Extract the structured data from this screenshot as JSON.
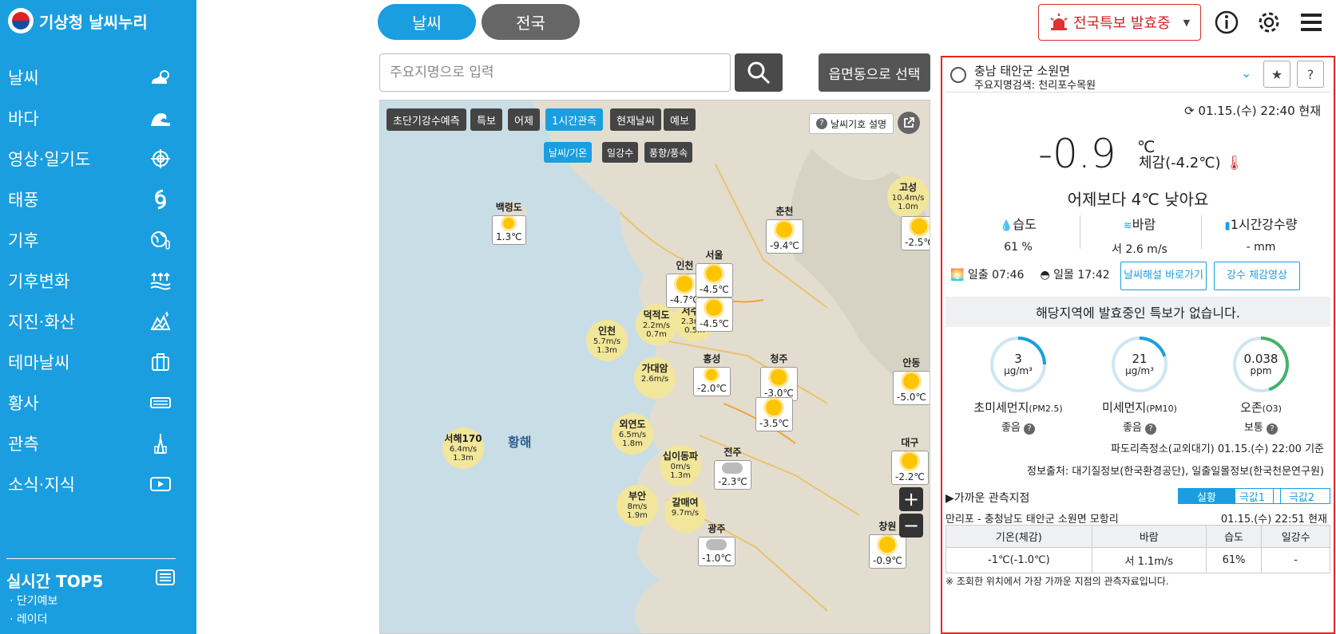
{
  "sidebar": {
    "title": "기상청 날씨누리",
    "items": [
      {
        "label": "날씨",
        "icon": "weather-icon"
      },
      {
        "label": "바다",
        "icon": "wave-icon"
      },
      {
        "label": "영상·일기도",
        "icon": "target-icon"
      },
      {
        "label": "태풍",
        "icon": "typhoon-icon"
      },
      {
        "label": "기후",
        "icon": "globe-icon"
      },
      {
        "label": "기후변화",
        "icon": "flood-icon"
      },
      {
        "label": "지진·화산",
        "icon": "earthquake-icon"
      },
      {
        "label": "테마날씨",
        "icon": "bag-icon"
      },
      {
        "label": "황사",
        "icon": "dust-icon"
      },
      {
        "label": "관측",
        "icon": "tower-icon"
      },
      {
        "label": "소식·지식",
        "icon": "video-icon"
      }
    ],
    "top5_title": "실시간 TOP5",
    "top5_links": [
      "· 단기예보",
      "· 레이더"
    ]
  },
  "top_tabs": {
    "weather": "날씨",
    "nation": "전국"
  },
  "search": {
    "placeholder": "주요지명으로 입력"
  },
  "emd_button": "읍면동으로 선택",
  "warning_button": "전국특보 발효중",
  "map": {
    "tabs": [
      "초단기강수예측",
      "특보",
      "어제",
      "1시간관측",
      "현재날씨",
      "예보"
    ],
    "active_tab": "1시간관측",
    "subtabs": [
      "날씨/기온",
      "일강수",
      "풍향/풍속"
    ],
    "active_subtab": "날씨/기온",
    "legend_label": "날씨기호 설명",
    "sea_label": "황해",
    "stations": [
      {
        "name": "백령도",
        "temp": "1.3℃",
        "icon": "sun-cloud"
      },
      {
        "name": "인천",
        "temp": "-4.7℃",
        "icon": "sun"
      },
      {
        "name": "서울",
        "temp": "-4.5℃",
        "icon": "sun"
      },
      {
        "name": "",
        "temp": "-4.5℃",
        "icon": "sun"
      },
      {
        "name": "춘천",
        "temp": "-9.4℃",
        "icon": "sun"
      },
      {
        "name": "",
        "temp": "-2.5℃",
        "icon": "sun"
      },
      {
        "name": "홍성",
        "temp": "-2.0℃",
        "icon": "sun-cloud"
      },
      {
        "name": "청주",
        "temp": "-3.0℃",
        "icon": "sun"
      },
      {
        "name": "",
        "temp": "-3.5℃",
        "icon": "sun"
      },
      {
        "name": "안동",
        "temp": "-5.0℃",
        "icon": "sun"
      },
      {
        "name": "전주",
        "temp": "-2.3℃",
        "icon": "cloud"
      },
      {
        "name": "대구",
        "temp": "-2.2℃",
        "icon": "sun"
      },
      {
        "name": "광주",
        "temp": "-1.0℃",
        "icon": "cloud"
      },
      {
        "name": "창원",
        "temp": "-0.9℃",
        "icon": "sun"
      }
    ],
    "buoys": [
      {
        "name": "고성",
        "wind": "10.4m/s",
        "wave": "1.0m"
      },
      {
        "name": "덕적도",
        "wind": "2.2m/s",
        "wave": "0.7m"
      },
      {
        "name": "서수도",
        "wind": "2.3m/s",
        "wave": "0.5m"
      },
      {
        "name": "인천",
        "wind": "5.7m/s",
        "wave": "1.3m"
      },
      {
        "name": "가대암",
        "wind": "2.6m/s",
        "wave": ""
      },
      {
        "name": "외연도",
        "wind": "6.5m/s",
        "wave": "1.8m"
      },
      {
        "name": "서해170",
        "wind": "6.4m/s",
        "wave": "1.3m"
      },
      {
        "name": "십이동파",
        "wind": "0m/s",
        "wave": "1.3m"
      },
      {
        "name": "부안",
        "wind": "8m/s",
        "wave": "1.9m"
      },
      {
        "name": "갈매여",
        "wind": "9.7m/s",
        "wave": ""
      }
    ]
  },
  "panel": {
    "location": "충남 태안군 소원면",
    "sub_location": "주요지명검색: 천리포수목원",
    "obs_time": "01.15.(수) 22:40 현재",
    "temperature": "-0.9",
    "temp_unit": "℃",
    "feels_like": "체감(-4.2℃)",
    "compare": "어제보다 4℃ 낮아요",
    "humidity_label": "습도",
    "humidity_value": "61 %",
    "wind_label": "바람",
    "wind_value": "서 2.6 m/s",
    "rain_label": "1시간강수량",
    "rain_value": "- mm",
    "sunrise": "일출  07:46",
    "sunset": "일몰  17:42",
    "link1": "날씨해설 바로가기",
    "link2": "강수 체감영상",
    "no_warning": "해당지역에 발효중인 특보가 없습니다.",
    "air": [
      {
        "value": "3",
        "unit": "μg/m³",
        "name": "초미세먼지",
        "sub": "(PM2.5)",
        "grade": "좋음",
        "color": "#1a9ee0",
        "level": 0.25
      },
      {
        "value": "21",
        "unit": "μg/m³",
        "name": "미세먼지",
        "sub": "(PM10)",
        "grade": "좋음",
        "color": "#1a9ee0",
        "level": 0.2
      },
      {
        "value": "0.038",
        "unit": "ppm",
        "name": "오존",
        "sub": "(O3)",
        "grade": "보통",
        "color": "#43b36a",
        "level": 0.45
      }
    ],
    "station_source": "파도리측정소(교외대기) 01.15.(수) 22:00 기준",
    "info_source": "정보출처: 대기질정보(한국환경공단), 일출일몰정보(한국천문연구원)",
    "near_title": "▶가까운 관측지점",
    "near_tabs": [
      "실황",
      "극값1",
      "극값2"
    ],
    "near_location": "만리포 - 충청남도 태안군 소원면 모항리",
    "near_time": "01.15.(수) 22:51 현재",
    "table_headers": [
      "기온(체감)",
      "바람",
      "습도",
      "일강수"
    ],
    "table_row": [
      "-1℃(-1.0℃)",
      "서 1.1m/s",
      "61%",
      "-"
    ],
    "note": "※ 조회한 위치에서 가장 가까운 지점의 관측자료입니다."
  }
}
